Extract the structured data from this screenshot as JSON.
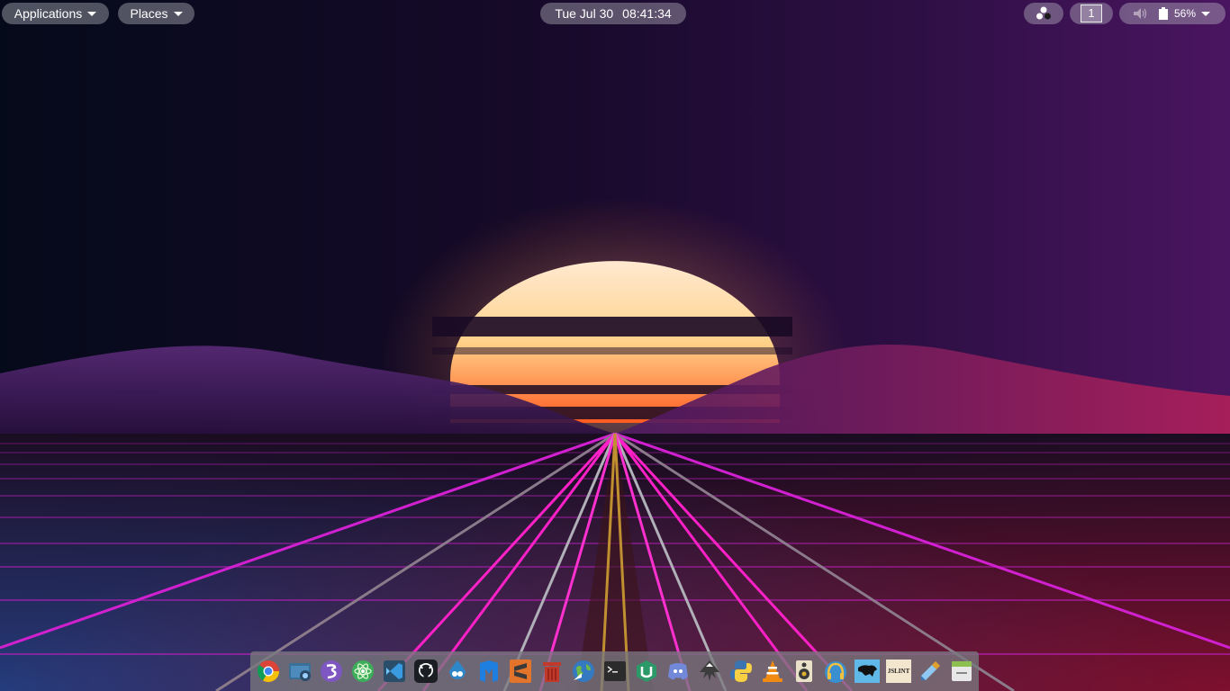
{
  "top_panel": {
    "applications_label": "Applications",
    "places_label": "Places",
    "clock_day": "Tue Jul 30",
    "clock_time": "08:41:34",
    "workspace_number": "1",
    "battery_percent": "56%"
  },
  "dock": {
    "icons": [
      "chrome-icon",
      "screenshot-icon",
      "emacs-icon",
      "atom-icon",
      "vscode-icon",
      "github-icon",
      "drupal-icon",
      "malwarebytes-icon",
      "sublime-icon",
      "trash-icon",
      "globe-browser-icon",
      "terminal-icon",
      "hexchat-icon",
      "discord-icon",
      "inkscape-icon",
      "python-icon",
      "vlc-icon",
      "speaker-icon",
      "headphones-icon",
      "panther-icon",
      "jslint-icon",
      "color-picker-icon",
      "window-manager-icon"
    ],
    "jslint_text": "JSLINT"
  },
  "colors": {
    "neon_magenta": "#e21ac8",
    "sun_core": "#fff2d8",
    "sun_orange": "#ff8a2a",
    "sky_purple": "#3a1248"
  }
}
